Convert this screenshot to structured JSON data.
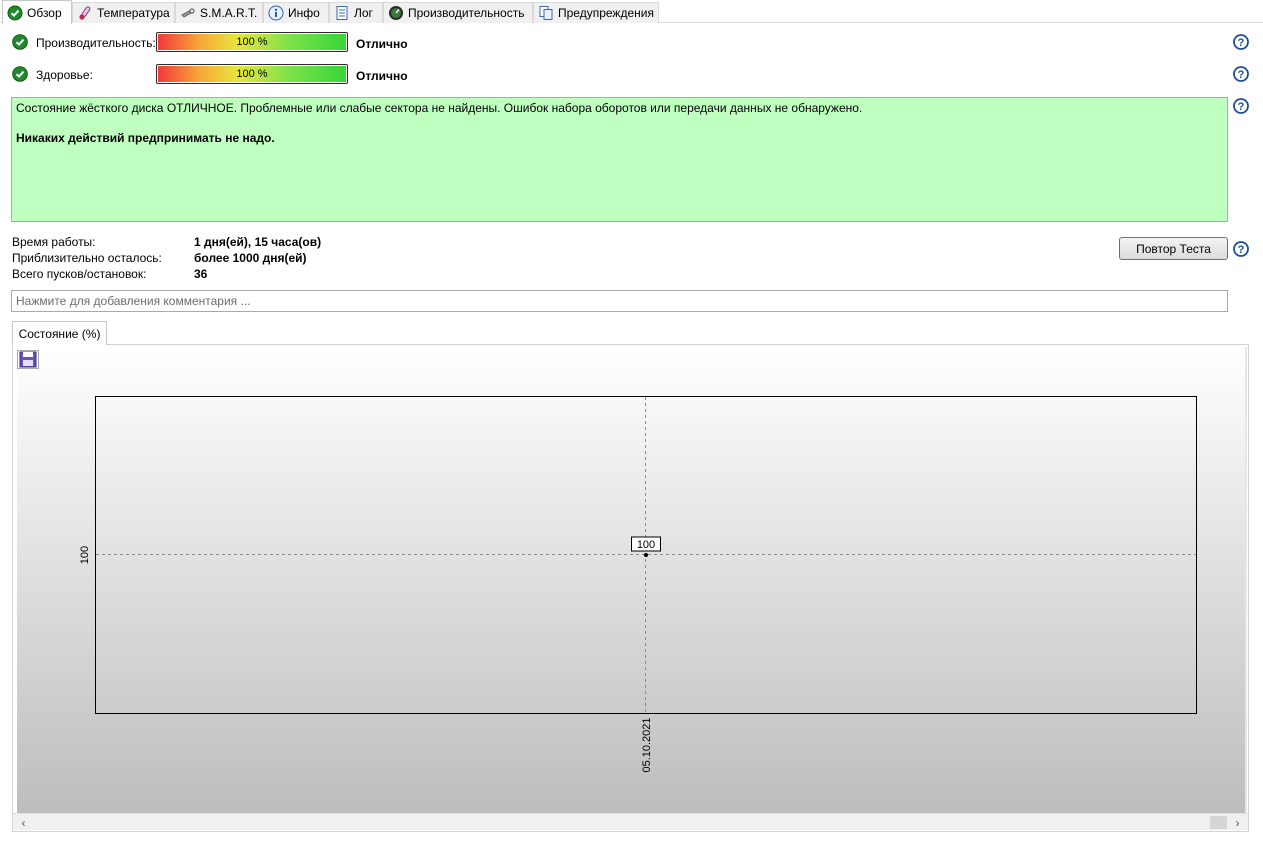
{
  "tabs": [
    {
      "label": "Обзор",
      "icon": "check-circle-icon",
      "active": true
    },
    {
      "label": "Температура",
      "icon": "thermometer-icon"
    },
    {
      "label": "S.M.A.R.T.",
      "icon": "smart-wrench-icon"
    },
    {
      "label": "Инфо",
      "icon": "info-icon"
    },
    {
      "label": "Лог",
      "icon": "log-icon"
    },
    {
      "label": "Производительность",
      "icon": "gauge-icon"
    },
    {
      "label": "Предупреждения",
      "icon": "warnings-icon"
    }
  ],
  "performance": {
    "label": "Производительность:",
    "percent_text": "100 %",
    "percent": 100,
    "rating": "Отлично"
  },
  "health": {
    "label": "Здоровье:",
    "percent_text": "100 %",
    "percent": 100,
    "rating": "Отлично"
  },
  "message": {
    "line1": "Состояние жёсткого диска ОТЛИЧНОЕ. Проблемные или слабые сектора не найдены. Ошибок набора оборотов или передачи данных не обнаружено.",
    "line2": "Никаких действий предпринимать не надо.",
    "bg_color": "#bfffbf"
  },
  "info": {
    "uptime_label": "Время работы:",
    "uptime_value": "1 дня(ей), 15 часа(ов)",
    "remaining_label": "Приблизительно осталось:",
    "remaining_value": "более 1000 дня(ей)",
    "starts_label": "Всего пусков/остановок:",
    "starts_value": "36"
  },
  "retest_label": "Повтор Теста",
  "comment_placeholder": "Нажмите для добавления комментария ...",
  "chart_tab_label": "Состояние (%)",
  "chart_data": {
    "type": "line",
    "x": [
      "05.10.2021"
    ],
    "series": [
      {
        "values": [
          100
        ]
      }
    ],
    "xlabel": "",
    "ylabel": "",
    "y_tick_labels": [
      "100"
    ],
    "x_tick_labels": [
      "05.10.2021"
    ],
    "data_labels": [
      "100"
    ],
    "grid": true
  }
}
